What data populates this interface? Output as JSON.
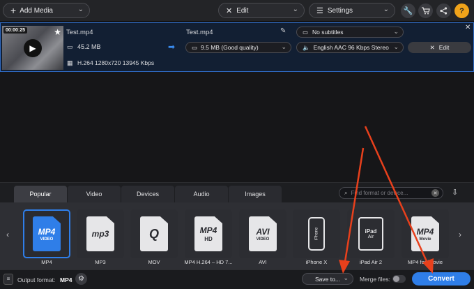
{
  "toolbar": {
    "add_media": "Add Media",
    "edit": "Edit",
    "settings": "Settings"
  },
  "file": {
    "time": "00:00:25",
    "source_name": "Test.mp4",
    "source_size": "45.2 MB",
    "source_info": "H.264 1280x720 13945 Kbps",
    "output_name": "Test.mp4",
    "output_size": "9.5 MB (Good quality)",
    "subtitles": "No subtitles",
    "audio": "English AAC 96 Kbps Stereo",
    "edit": "Edit"
  },
  "tabs": [
    "Popular",
    "Video",
    "Devices",
    "Audio",
    "Images"
  ],
  "active_tab": "Popular",
  "search_placeholder": "Find format or device...",
  "formats": [
    {
      "label": "MP4",
      "big": "MP4",
      "small": "VIDEO",
      "selected": true
    },
    {
      "label": "MP3",
      "big": "mp3",
      "small": "",
      "selected": false
    },
    {
      "label": "MOV",
      "big": "Q",
      "small": "",
      "selected": false
    },
    {
      "label": "MP4 H.264 – HD 7...",
      "big": "MP4",
      "small": "HD",
      "selected": false
    },
    {
      "label": "AVI",
      "big": "AVI",
      "small": "VIDEO",
      "selected": false
    },
    {
      "label": "iPhone X",
      "big": "iPhone",
      "small": "",
      "selected": false
    },
    {
      "label": "iPad Air 2",
      "big": "iPad",
      "small": "Air",
      "selected": false
    },
    {
      "label": "MP4 for iMovie",
      "big": "MP4",
      "small": "Movie",
      "selected": false
    }
  ],
  "bottom": {
    "output_label": "Output format:",
    "output_value": "MP4",
    "save_to": "Save to...",
    "merge": "Merge files:",
    "convert": "Convert"
  },
  "colors": {
    "accent": "#2f7ee8",
    "annotation_arrow": "#e8401c"
  },
  "icons": [
    "plus-icon",
    "edit-tools-icon",
    "settings-sliders-icon",
    "wrench-icon",
    "cart-icon",
    "share-icon",
    "help-icon",
    "star-icon",
    "play-icon",
    "file-icon",
    "film-icon",
    "arrow-icon",
    "pencil-icon",
    "subtitles-icon",
    "speaker-icon",
    "close-icon",
    "search-icon",
    "clear-icon",
    "import-icon",
    "chevron-left-icon",
    "chevron-right-icon",
    "list-icon",
    "gear-icon"
  ]
}
